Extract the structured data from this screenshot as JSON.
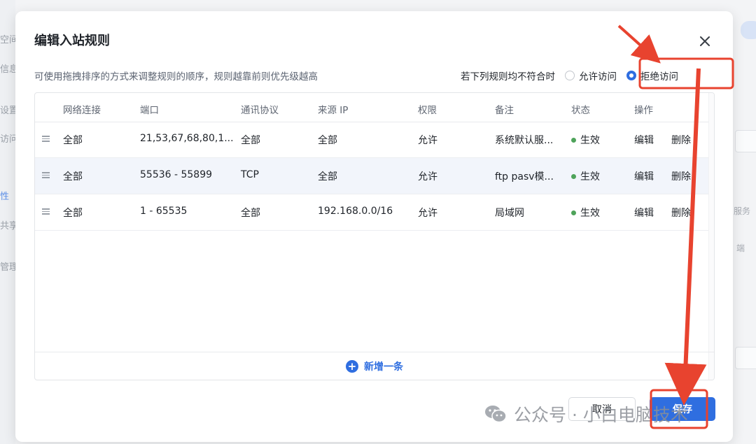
{
  "background": {
    "left_items": [
      "空间",
      "信息",
      "设置",
      "访问",
      "性",
      "共享",
      "管理"
    ],
    "right_items": [
      "服务",
      "端"
    ]
  },
  "dialog": {
    "title": "编辑入站规则",
    "close_icon": "close-icon",
    "description": "可使用拖拽排序的方式来调整规则的顺序，规则越靠前则优先级越高",
    "policy": {
      "label": "若下列规则均不符合时",
      "options": [
        {
          "label": "允许访问",
          "selected": false
        },
        {
          "label": "拒绝访问",
          "selected": true
        }
      ]
    },
    "table": {
      "columns": [
        "网络连接",
        "端口",
        "通讯协议",
        "来源 IP",
        "权限",
        "备注",
        "状态",
        "操作"
      ],
      "rows": [
        {
          "network": "全部",
          "port": "21,53,67,68,80,1...",
          "protocol": "全部",
          "source": "全部",
          "permission": "允许",
          "note": "系统默认服...",
          "status": "生效",
          "edit": "编辑",
          "delete": "删除",
          "highlighted": false
        },
        {
          "network": "全部",
          "port": "55536 - 55899",
          "protocol": "TCP",
          "source": "全部",
          "permission": "允许",
          "note": "ftp pasv模...",
          "status": "生效",
          "edit": "编辑",
          "delete": "删除",
          "highlighted": true
        },
        {
          "network": "全部",
          "port": "1 - 65535",
          "protocol": "全部",
          "source": "192.168.0.0/16",
          "permission": "允许",
          "note": "局域网",
          "status": "生效",
          "edit": "编辑",
          "delete": "删除",
          "highlighted": false
        }
      ],
      "add_label": "新增一条"
    },
    "buttons": {
      "cancel": "取消",
      "save": "保存"
    }
  },
  "watermark": "公众号 · 小白电脑技术",
  "colors": {
    "primary": "#2f6ee0",
    "status_active": "#4ea35a",
    "annotation": "#e8432f"
  }
}
